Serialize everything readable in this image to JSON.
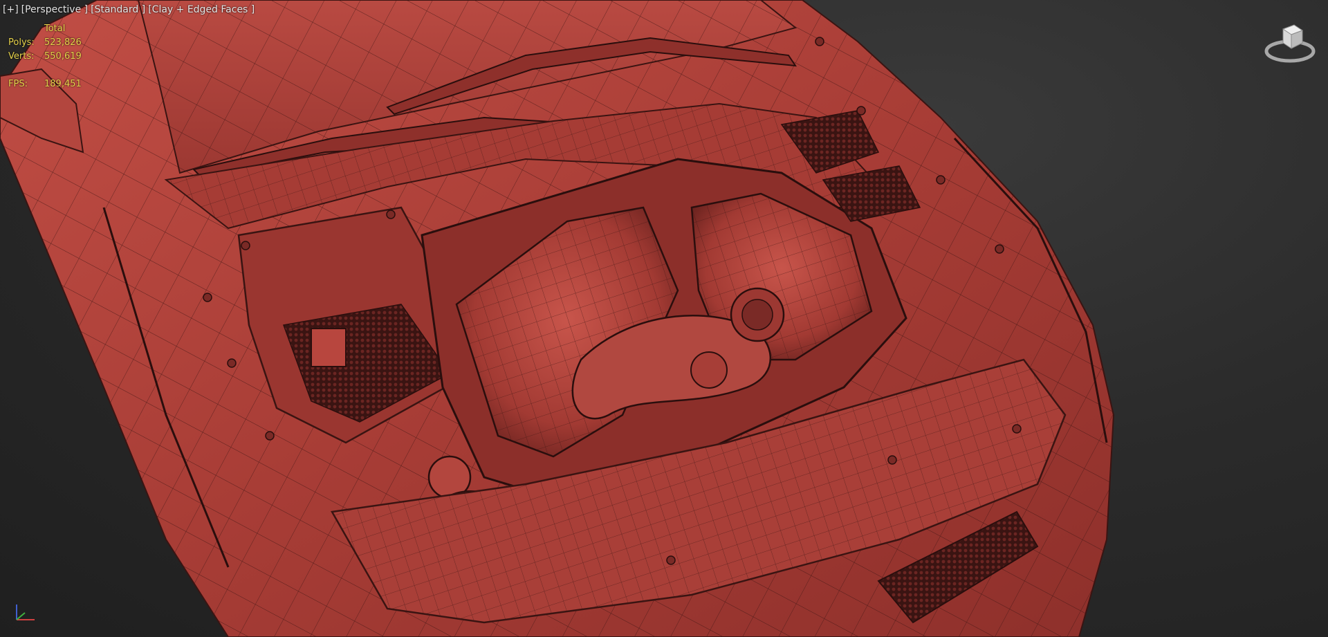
{
  "viewport": {
    "labels": [
      "[+]",
      "[Perspective ]",
      "[Standard ]",
      "[Clay + Edged Faces ]"
    ]
  },
  "stats": {
    "total_label": "Total",
    "polys_label": "Polys:",
    "polys_value": "523,826",
    "verts_label": "Verts:",
    "verts_value": "550,619",
    "fps_label": "FPS:",
    "fps_value": "189,451"
  },
  "colors": {
    "clay": "#b8463e",
    "clay_dark": "#7a2a26",
    "wire": "#3a1412",
    "stats_text": "#e6d24a",
    "label_text": "#e6e6e6",
    "background": "#2b2b2b"
  },
  "icons": {
    "viewcube": "viewcube-icon",
    "axis_tripod": "axis-tripod-icon"
  }
}
